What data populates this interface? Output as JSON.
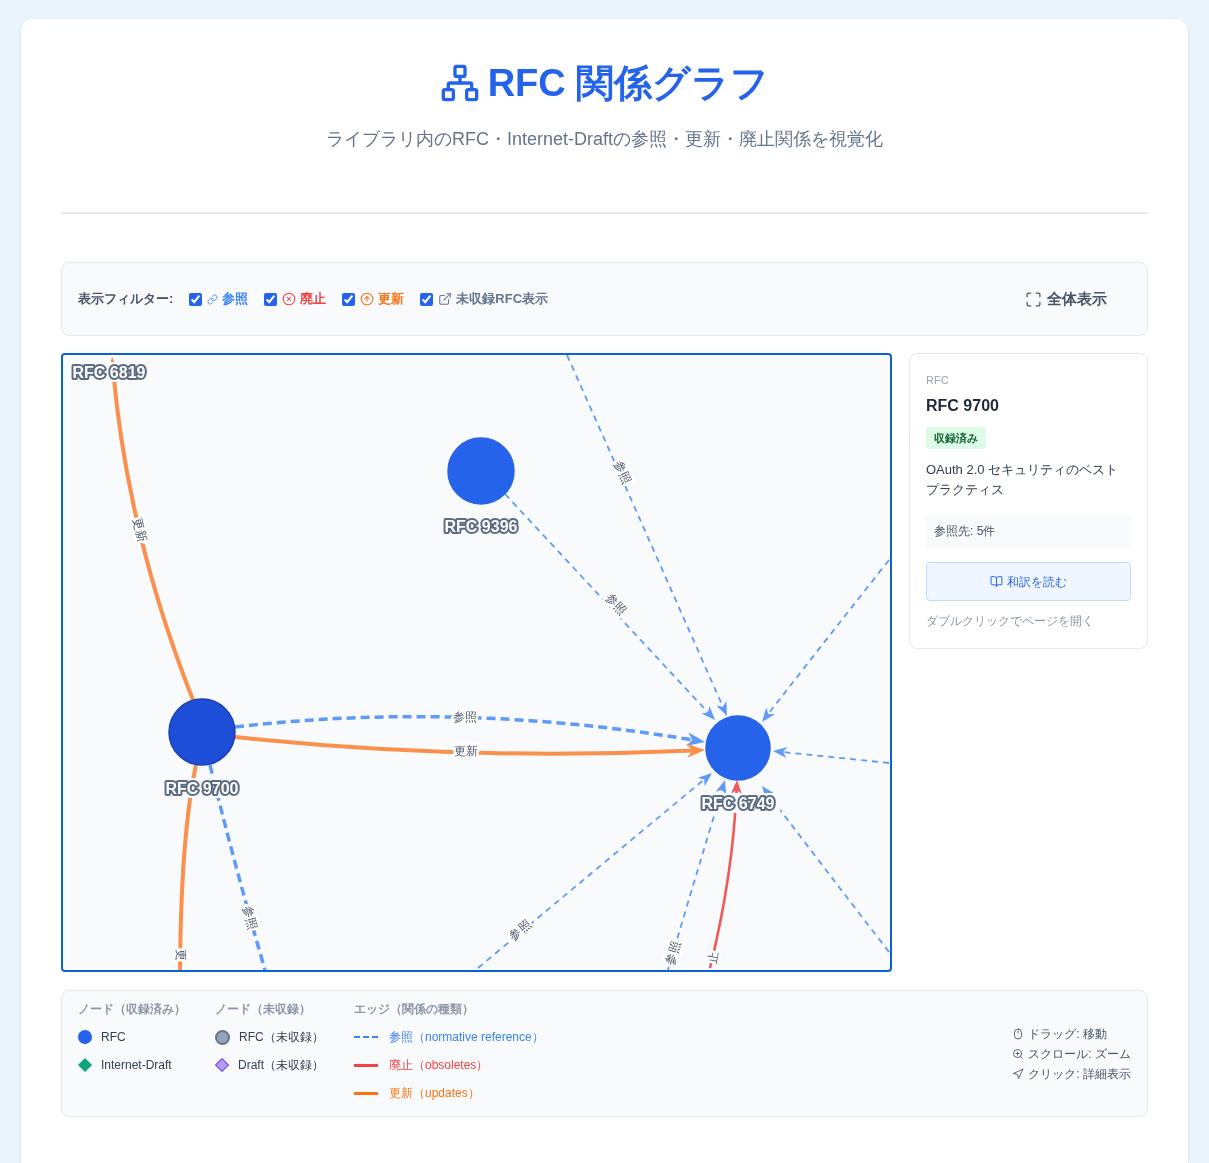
{
  "header": {
    "title": "RFC 関係グラフ",
    "subtitle": "ライブラリ内のRFC・Internet-Draftの参照・更新・廃止関係を視覚化"
  },
  "filters": {
    "label": "表示フィルター:",
    "items": [
      {
        "kind": "reference",
        "label": "参照",
        "checked": true
      },
      {
        "kind": "obsoletes",
        "label": "廃止",
        "checked": true
      },
      {
        "kind": "updates",
        "label": "更新",
        "checked": true
      },
      {
        "kind": "uncollected",
        "label": "未収録RFC表示",
        "checked": true
      }
    ],
    "fit_button": "全体表示"
  },
  "graph": {
    "nodes": [
      {
        "label": "RFC 6819"
      },
      {
        "label": "RFC 9396",
        "selected": false
      },
      {
        "label": "RFC 9700",
        "selected": true
      },
      {
        "label": "RFC 6749",
        "selected": false
      }
    ],
    "edges": [
      {
        "kind": "updates",
        "label": "更新"
      },
      {
        "kind": "reference",
        "label": "参照"
      },
      {
        "kind": "updates",
        "label": "更新"
      },
      {
        "kind": "reference",
        "label": "参照"
      },
      {
        "kind": "reference",
        "label": "参照"
      },
      {
        "kind": "reference"
      },
      {
        "kind": "reference"
      },
      {
        "kind": "reference"
      },
      {
        "kind": "reference",
        "label": "参照"
      },
      {
        "kind": "reference",
        "label": "参照"
      },
      {
        "kind": "obsoletes",
        "label": "止"
      },
      {
        "kind": "reference",
        "label": "参照"
      },
      {
        "kind": "updates",
        "label": "更"
      }
    ]
  },
  "details": {
    "type": "RFC",
    "title": "RFC 9700",
    "status": "収録済み",
    "description": "OAuth 2.0 セキュリティのベストプラクティス",
    "references": "参照先: 5件",
    "read_button": "和訳を読む",
    "hint": "ダブルクリックでページを開く"
  },
  "legend": {
    "groups": [
      {
        "title": "ノード（収録済み）",
        "items": [
          {
            "kind": "circle",
            "label": "RFC",
            "color": "#2563eb"
          },
          {
            "kind": "diamond",
            "label": "Internet-Draft",
            "color": "#10a37f"
          }
        ]
      },
      {
        "title": "ノード（未収録）",
        "items": [
          {
            "kind": "ring",
            "label": "RFC（未収録）",
            "color": "#94a3b8"
          },
          {
            "kind": "diamond-outline",
            "label": "Draft（未収録）",
            "color": "#b39dfa"
          }
        ]
      },
      {
        "title": "エッジ（関係の種類）",
        "items": [
          {
            "kind": "dashed",
            "label": "参照（normative reference）",
            "color": "#3b82f6"
          },
          {
            "kind": "solid",
            "label": "廃止（obsoletes）",
            "color": "#ef4444"
          },
          {
            "kind": "solid",
            "label": "更新（updates）",
            "color": "#f97316"
          }
        ]
      }
    ],
    "hints": [
      {
        "kind": "mouse",
        "label": "ドラッグ: 移動"
      },
      {
        "kind": "zoom",
        "label": "スクロール: ズーム"
      },
      {
        "kind": "pointer",
        "label": "クリック: 詳細表示"
      }
    ]
  }
}
